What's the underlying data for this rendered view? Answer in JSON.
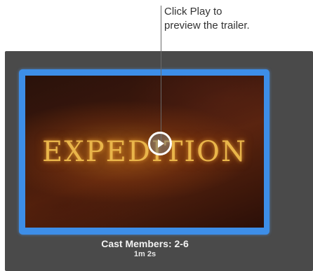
{
  "callout": {
    "line1": "Click Play to",
    "line2": "preview the trailer."
  },
  "trailer": {
    "title": "EXPEDITION",
    "cast_members": "Cast Members: 2-6",
    "duration": "1m 2s"
  },
  "colors": {
    "selection_border": "#3d8ee8",
    "panel_background": "#4a4a4a",
    "title_gold": "#e9b54a"
  },
  "icons": {
    "play": "play-icon"
  }
}
